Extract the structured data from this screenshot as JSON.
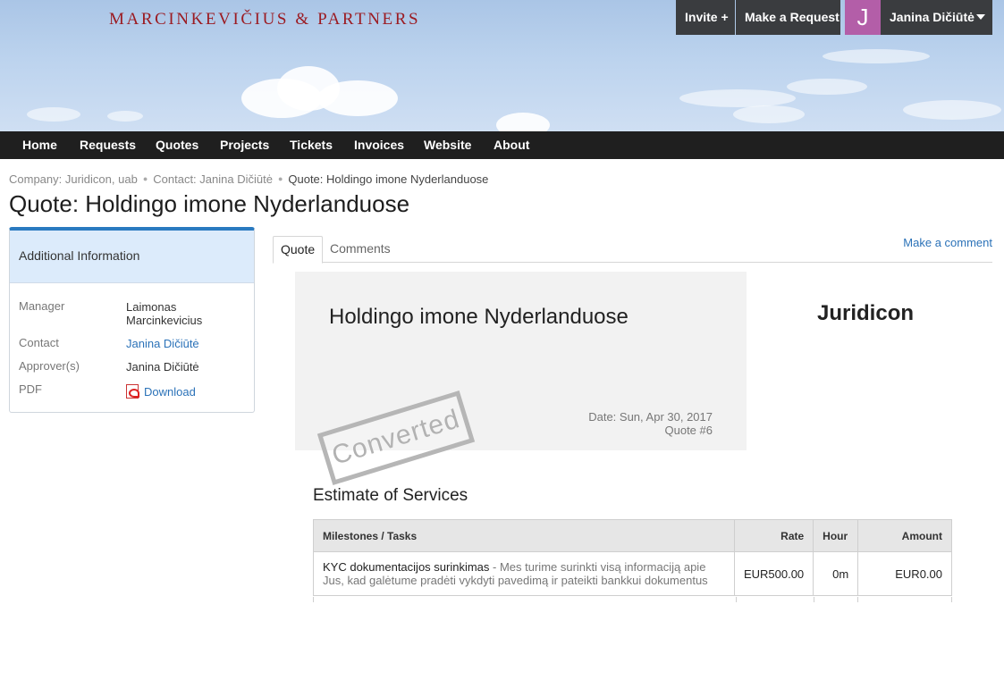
{
  "header": {
    "brand": "MARCINKEVIČIUS & PARTNERS",
    "invite_label": "Invite +",
    "request_label": "Make a Request",
    "user_initial": "J",
    "user_name": "Janina Dičiūtė"
  },
  "nav": {
    "items": [
      "Home",
      "Requests",
      "Quotes",
      "Projects",
      "Tickets",
      "Invoices",
      "Website",
      "About"
    ]
  },
  "breadcrumb": {
    "company": "Company: Juridicon, uab",
    "contact": "Contact: Janina Dičiūtė",
    "current": "Quote: Holdingo imone Nyderlanduose"
  },
  "page_title": "Quote: Holdingo imone Nyderlanduose",
  "sidebar": {
    "title": "Additional Information",
    "manager_label": "Manager",
    "manager_value": "Laimonas Marcinkevicius",
    "contact_label": "Contact",
    "contact_value": "Janina Dičiūtė",
    "approver_label": "Approver(s)",
    "approver_value": "Janina Dičiūtė",
    "pdf_label": "PDF",
    "pdf_link": "Download"
  },
  "tabs": {
    "quote": "Quote",
    "comments": "Comments",
    "make_comment": "Make a comment"
  },
  "quote": {
    "name": "Holdingo imone Nyderlanduose",
    "date": "Date: Sun, Apr 30, 2017",
    "number": "Quote #6",
    "stamp": "Converted",
    "company": "Juridicon"
  },
  "estimate": {
    "title": "Estimate of Services",
    "headers": {
      "task": "Milestones / Tasks",
      "rate": "Rate",
      "hour": "Hour",
      "amount": "Amount"
    },
    "rows": [
      {
        "task": "KYC dokumentacijos surinkimas",
        "description": " - Mes turime surinkti visą informaciją apie Jus, kad galėtume pradėti vykdyti pavedimą ir pateikti bankkui dokumentus",
        "rate": "EUR500.00",
        "hour": "0m",
        "amount": "EUR0.00"
      }
    ]
  },
  "colors": {
    "brand": "#9b1b22",
    "nav_bg": "#1f1f1f",
    "link": "#2b72b8",
    "avatar": "#b35ea8",
    "panel_accent": "#2a7ac0"
  }
}
